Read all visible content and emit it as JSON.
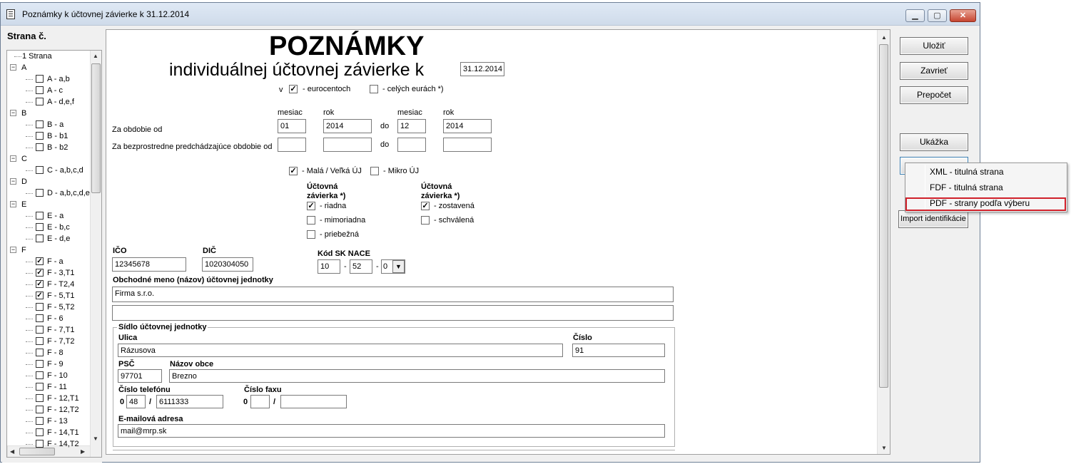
{
  "window": {
    "title": "Poznámky k účtovnej závierke k 31.12.2014",
    "min_label": "▁",
    "max_label": "▢",
    "close_label": "✕"
  },
  "sidebar": {
    "header": "Strana č.",
    "items": [
      {
        "label": "1 Strana"
      },
      {
        "label": "A"
      },
      {
        "label": "A - a,b"
      },
      {
        "label": "A - c"
      },
      {
        "label": "A - d,e,f"
      },
      {
        "label": "B"
      },
      {
        "label": "B - a"
      },
      {
        "label": "B - b1"
      },
      {
        "label": "B - b2"
      },
      {
        "label": "C"
      },
      {
        "label": "C - a,b,c,d"
      },
      {
        "label": "D"
      },
      {
        "label": "D - a,b,c,d,e"
      },
      {
        "label": "E"
      },
      {
        "label": "E - a"
      },
      {
        "label": "E - b,c"
      },
      {
        "label": "E - d,e"
      },
      {
        "label": "F"
      },
      {
        "label": "F - a"
      },
      {
        "label": "F - 3,T1"
      },
      {
        "label": "F - T2,4"
      },
      {
        "label": "F - 5,T1"
      },
      {
        "label": "F - 5,T2"
      },
      {
        "label": "F - 6"
      },
      {
        "label": "F - 7,T1"
      },
      {
        "label": "F - 7,T2"
      },
      {
        "label": "F - 8"
      },
      {
        "label": "F - 9"
      },
      {
        "label": "F - 10"
      },
      {
        "label": "F - 11"
      },
      {
        "label": "F - 12,T1"
      },
      {
        "label": "F - 12,T2"
      },
      {
        "label": "F - 13"
      },
      {
        "label": "F - 14,T1"
      },
      {
        "label": "F - 14,T2"
      }
    ]
  },
  "form": {
    "heading": "POZNÁMKY",
    "subheading": "individuálnej účtovnej závierke k",
    "date": "31.12.2014",
    "v_label": "v",
    "eurocent_label": "- eurocentoch",
    "cele_eura_label": "- celých eurách *)",
    "mesiac": "mesiac",
    "rok": "rok",
    "do": "do",
    "obdobie_od_label": "Za obdobie od",
    "predch_obdobie_label": "Za bezprostredne predchádzajúce obdobie od",
    "period": {
      "from_month": "01",
      "from_year": "2014",
      "to_month": "12",
      "to_year": "2014"
    },
    "mala_label": "- Malá / Veľká ÚJ",
    "mikro_label": "- Mikro ÚJ",
    "zavierka1_title1": "Účtovná",
    "zavierka1_title2": "závierka *)",
    "riadna": "- riadna",
    "mimoriadna": "- mimoriadna",
    "priebezna": "- priebežná",
    "zavierka2_title1": "Účtovná",
    "zavierka2_title2": "závierka *)",
    "zostavena": "- zostavená",
    "schvalena": "- schválená",
    "ico_label": "IČO",
    "ico": "12345678",
    "dic_label": "DIČ",
    "dic": "1020304050",
    "nace_label": "Kód SK NACE",
    "nace1": "10",
    "nace2": "52",
    "nace3": "0",
    "nace_dash": "-",
    "obchodne_meno_label": "Obchodné meno (názov) účtovnej jednotky",
    "obchodne_meno": "Firma s.r.o.",
    "sidlo_label": "Sídlo účtovnej jednotky",
    "ulica_label": "Ulica",
    "ulica": "Rázusova",
    "cislo_label": "Číslo",
    "cislo": "91",
    "psc_label": "PSČ",
    "psc": "97701",
    "obec_label": "Názov obce",
    "obec": "Brezno",
    "telefon_label": "Číslo telefónu",
    "tel_prefix": "0",
    "tel_area": "48",
    "tel_slash": "/",
    "tel_number": "6111333",
    "fax_label": "Číslo faxu",
    "fax_prefix": "0",
    "fax_slash": "/",
    "email_label": "E-mailová adresa",
    "email": "mail@mrp.sk"
  },
  "buttons": {
    "ulozit": "Uložiť",
    "zavriet": "Zavrieť",
    "prepocet": "Prepočet",
    "ukazka": "Ukážka",
    "import": "Import identifikácie"
  },
  "popup_menu": {
    "items": [
      "XML - titulná strana",
      "FDF - titulná strana",
      "PDF - strany podľa výberu"
    ],
    "highlighted_index": 2
  }
}
